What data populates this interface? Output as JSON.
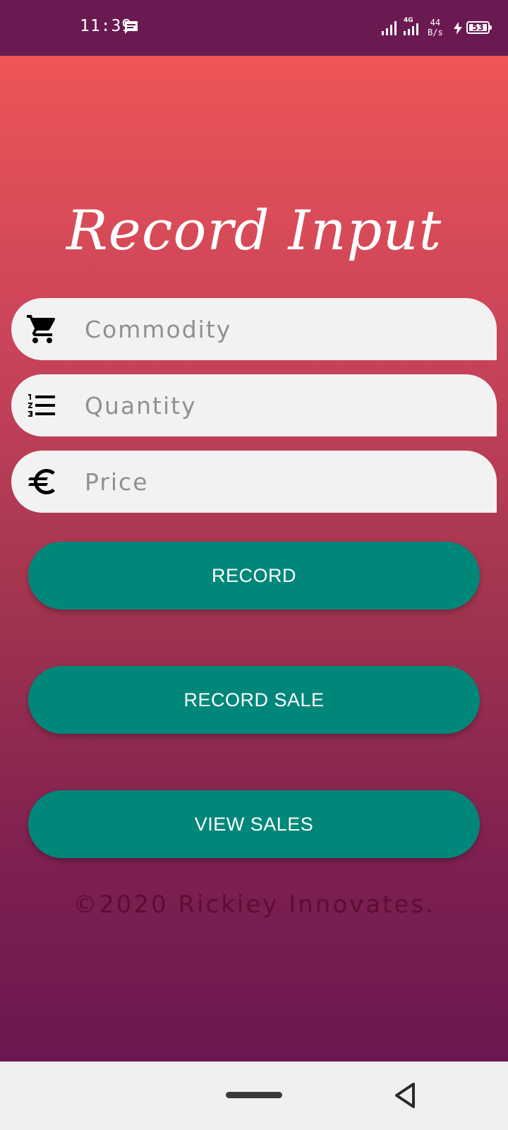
{
  "status_bar": {
    "time": "11:39",
    "network": "4G",
    "speed_value": "44",
    "speed_unit": "B/s",
    "battery": "53"
  },
  "title": "Record Input",
  "fields": {
    "commodity": {
      "placeholder": "Commodity",
      "value": "",
      "icon": "cart-icon"
    },
    "quantity": {
      "placeholder": "Quantity",
      "value": "",
      "icon": "numbered-list-icon"
    },
    "price": {
      "placeholder": "Price",
      "value": "",
      "icon": "euro-icon"
    }
  },
  "buttons": {
    "record": "RECORD",
    "record_sale": "RECORD SALE",
    "view_sales": "VIEW SALES"
  },
  "footer": "©2020 Rickiey Innovates.",
  "colors": {
    "status_bar": "#6a1a51",
    "gradient_top": "#ee5556",
    "gradient_bottom": "#6c1750",
    "button": "#01877a",
    "field_bg": "#f3f2f2",
    "nav_bar": "#f0f0f0"
  }
}
